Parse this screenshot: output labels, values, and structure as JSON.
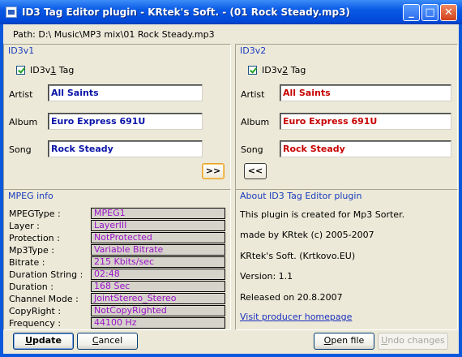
{
  "window": {
    "title": "ID3 Tag Editor plugin - KRtek's Soft. - (01 Rock Steady.mp3)",
    "minimize_glyph": "_",
    "maximize_glyph": "□",
    "close_glyph": "✕"
  },
  "path_text": "Path: D:\\  Music\\MP3 mix\\01 Rock Steady.mp3",
  "id3v1": {
    "title": "ID3v1",
    "checkbox_prefix": "ID3v",
    "checkbox_underlined": "1",
    "checkbox_suffix": " Tag",
    "checked": true,
    "artist_label": "Artist",
    "album_label": "Album",
    "song_label": "Song",
    "artist": "All Saints",
    "album": "Euro Express 691U",
    "song": "Rock Steady",
    "copy_button": ">>"
  },
  "id3v2": {
    "title": "ID3v2",
    "checkbox_prefix": "ID3v",
    "checkbox_underlined": "2",
    "checkbox_suffix": " Tag",
    "checked": true,
    "artist_label": "Artist",
    "album_label": "Album",
    "song_label": "Song",
    "artist": "All Saints",
    "album": "Euro Express 691U",
    "song": "Rock Steady",
    "copy_button": "<<"
  },
  "mpeg": {
    "title": "MPEG info",
    "rows": [
      {
        "key": "MPEGType :",
        "value": "MPEG1"
      },
      {
        "key": "Layer :",
        "value": "LayerIII"
      },
      {
        "key": "Protection :",
        "value": "NotProtected"
      },
      {
        "key": "Mp3Type :",
        "value": "Variable Bitrate"
      },
      {
        "key": "Bitrate :",
        "value": "215 Kbits/sec"
      },
      {
        "key": "Duration String :",
        "value": "02:48"
      },
      {
        "key": "Duration :",
        "value": "168 Sec"
      },
      {
        "key": "Channel Mode :",
        "value": "JointStereo_Stereo"
      },
      {
        "key": "CopyRight :",
        "value": "NotCopyRighted"
      },
      {
        "key": "Frequency :",
        "value": "44100 Hz"
      }
    ]
  },
  "about": {
    "title": "About ID3 Tag Editor plugin",
    "line1": "This plugin is created for Mp3 Sorter.",
    "line2": "made by KRtek (c) 2005-2007",
    "line3": "KRtek's Soft. (Krtkovo.EU)",
    "line4": "Version: 1.1",
    "line5": "Released on 20.8.2007",
    "link": "Visit producer homepage"
  },
  "buttons": {
    "update_u": "U",
    "update_rest": "pdate",
    "cancel_u": "C",
    "cancel_rest": "ancel",
    "open_u": "O",
    "open_rest": "pen file",
    "undo_u": "U",
    "undo_rest": "ndo changes"
  },
  "colors": {
    "v1_text": "#0a14a8",
    "v2_text": "#c80000",
    "mpeg_text": "#9a12c8",
    "group_title": "#1a3cbe"
  }
}
